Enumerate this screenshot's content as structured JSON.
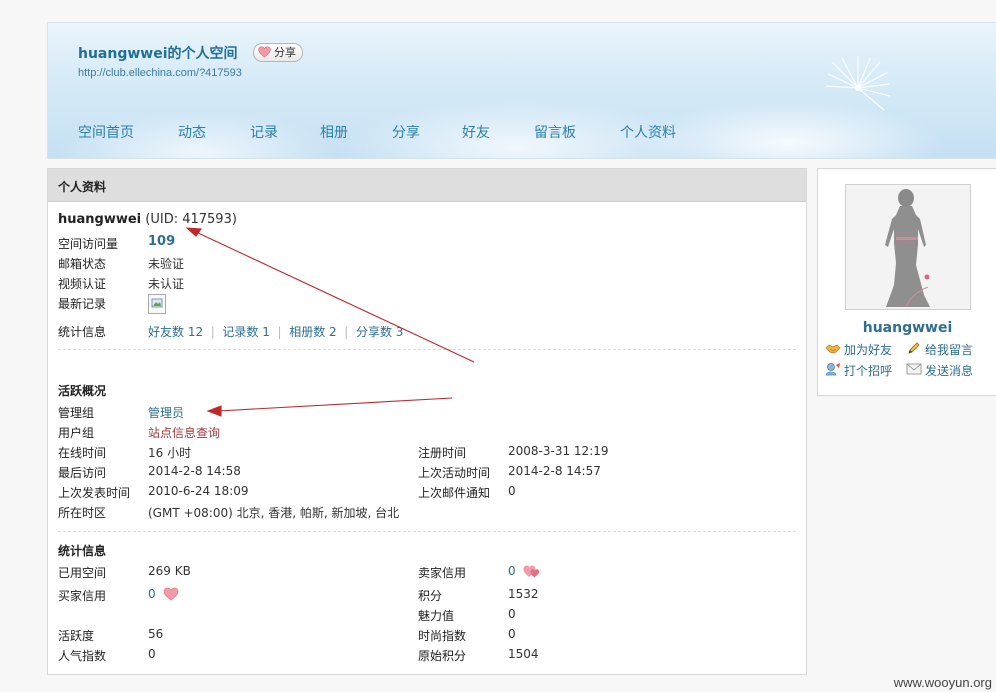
{
  "header": {
    "title": "huangwwei的个人空间",
    "share_label": "分享",
    "url": "http://club.ellechina.com/?417593",
    "nav": [
      "空间首页",
      "动态",
      "记录",
      "相册",
      "分享",
      "好友",
      "留言板",
      "个人资料"
    ]
  },
  "profile": {
    "panel_title": "个人资料",
    "username": "huangwwei",
    "uid_text": "(UID: 417593)",
    "visits_label": "空间访问量",
    "visits_value": "109",
    "email_label": "邮箱状态",
    "email_value": "未验证",
    "video_label": "视频认证",
    "video_value": "未认证",
    "latest_label": "最新记录",
    "stats_label": "统计信息",
    "stats_links": [
      "好友数 12",
      "记录数 1",
      "相册数 2",
      "分享数 3"
    ]
  },
  "activity": {
    "title": "活跃概况",
    "admin_group_label": "管理组",
    "admin_group_value": "管理员",
    "user_group_label": "用户组",
    "user_group_value": "站点信息查询",
    "online_label": "在线时间",
    "online_value": "16 小时",
    "register_label": "注册时间",
    "register_value": "2008-3-31 12:19",
    "last_visit_label": "最后访问",
    "last_visit_value": "2014-2-8 14:58",
    "last_active_label": "上次活动时间",
    "last_active_value": "2014-2-8 14:57",
    "last_post_label": "上次发表时间",
    "last_post_value": "2010-6-24 18:09",
    "last_mail_label": "上次邮件通知",
    "last_mail_value": "0",
    "timezone_label": "所在时区",
    "timezone_value": "(GMT +08:00) 北京, 香港, 帕斯, 新加坡, 台北"
  },
  "stats": {
    "title": "统计信息",
    "used_space_label": "已用空间",
    "used_space_value": "269 KB",
    "seller_credit_label": "卖家信用",
    "seller_credit_value": "0",
    "buyer_credit_label": "买家信用",
    "buyer_credit_value": "0",
    "points_label": "积分",
    "points_value": "1532",
    "charm_label": "魅力值",
    "charm_value": "0",
    "activity_label": "活跃度",
    "activity_value": "56",
    "fashion_label": "时尚指数",
    "fashion_value": "0",
    "popularity_label": "人气指数",
    "popularity_value": "0",
    "raw_points_label": "原始积分",
    "raw_points_value": "1504"
  },
  "card": {
    "username": "huangwwei",
    "add_friend": "加为好友",
    "leave_message": "给我留言",
    "greet": "打个招呼",
    "send_message": "发送消息"
  },
  "watermark": "www.wooyun.org",
  "colors": {
    "link": "#2d6f91",
    "nav": "#2d80a8",
    "annotation_arrow": "#c0282a",
    "user_group": "#a33a3a"
  }
}
